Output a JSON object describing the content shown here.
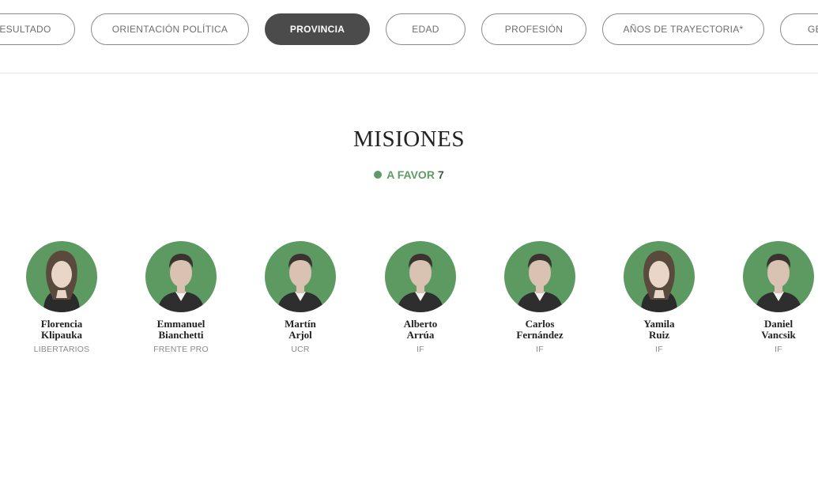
{
  "tabs": [
    {
      "label": "RESULTADO",
      "active": false
    },
    {
      "label": "ORIENTACIÓN POLÍTICA",
      "active": false
    },
    {
      "label": "PROVINCIA",
      "active": true
    },
    {
      "label": "EDAD",
      "active": false
    },
    {
      "label": "PROFESIÓN",
      "active": false
    },
    {
      "label": "AÑOS DE TRAYECTORIA*",
      "active": false
    },
    {
      "label": "GÉNERO",
      "active": false
    }
  ],
  "section": {
    "province": "MISIONES",
    "vote_label": "A FAVOR",
    "vote_count": "7",
    "vote_color": "#5e9b66"
  },
  "legislators": [
    {
      "first": "Florencia",
      "last": "Klipauka",
      "party": "LIBERTARIOS",
      "photo": "woman-portrait"
    },
    {
      "first": "Emmanuel",
      "last": "Bianchetti",
      "party": "FRENTE PRO",
      "photo": "man-portrait"
    },
    {
      "first": "Martín",
      "last": "Arjol",
      "party": "UCR",
      "photo": "man-portrait"
    },
    {
      "first": "Alberto",
      "last": "Arrúa",
      "party": "IF",
      "photo": "man-portrait"
    },
    {
      "first": "Carlos",
      "last": "Fernández",
      "party": "IF",
      "photo": "man-portrait"
    },
    {
      "first": "Yamila",
      "last": "Ruiz",
      "party": "IF",
      "photo": "woman-portrait"
    },
    {
      "first": "Daniel",
      "last": "Vancsik",
      "party": "IF",
      "photo": "man-portrait"
    }
  ]
}
